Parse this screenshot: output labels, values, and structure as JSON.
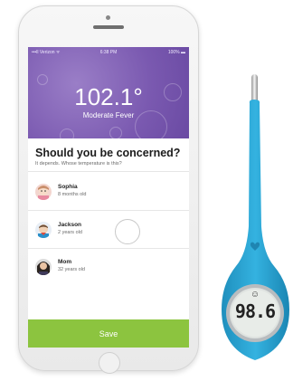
{
  "status_bar": {
    "carrier": "•••ll Verizon ᯤ",
    "time": "6:38 PM",
    "battery": "100% ▬"
  },
  "reading": {
    "temperature": "102.1°",
    "label": "Moderate Fever"
  },
  "question": {
    "title": "Should you be concerned?",
    "subtitle": "It depends. Whose temperature is this?"
  },
  "people": [
    {
      "name": "Sophia",
      "age": "8 months old"
    },
    {
      "name": "Jackson",
      "age": "2 years old"
    },
    {
      "name": "Mom",
      "age": "32 years old"
    }
  ],
  "save_label": "Save",
  "device": {
    "display_value": "98.6",
    "face_icon": "☺"
  },
  "colors": {
    "header": "#7a59b0",
    "save": "#8cc43f",
    "thermometer": "#2aa6d6"
  }
}
